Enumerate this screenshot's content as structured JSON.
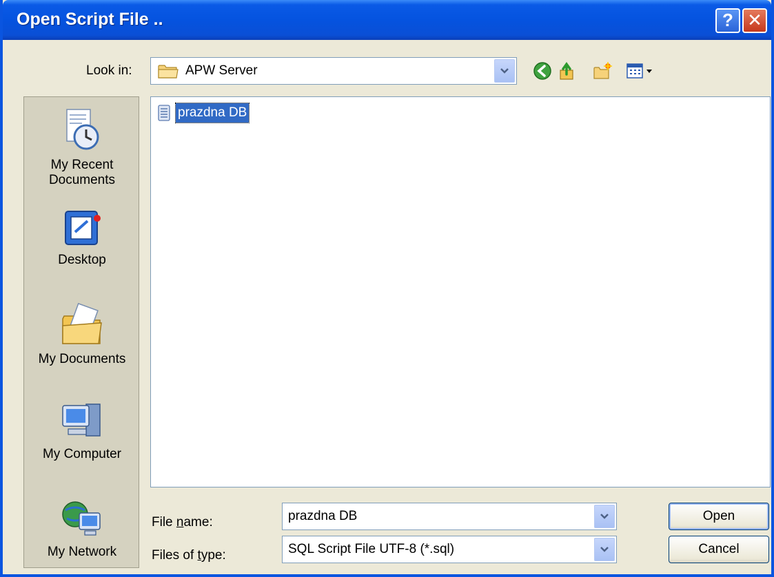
{
  "window": {
    "title": "Open Script File .."
  },
  "titlebar": {
    "help_glyph": "?",
    "close_glyph": "✕"
  },
  "lookin": {
    "label": "Look in:",
    "value": "APW Server"
  },
  "toolbar": {
    "icons": [
      "back-icon",
      "up-folder-icon",
      "new-folder-icon",
      "views-menu-icon"
    ]
  },
  "places": [
    {
      "line1": "My Recent",
      "line2": "Documents",
      "icon": "recent-documents-icon"
    },
    {
      "line1": "Desktop",
      "line2": "",
      "icon": "desktop-icon"
    },
    {
      "line1": "My Documents",
      "line2": "",
      "icon": "my-documents-icon"
    },
    {
      "line1": "My Computer",
      "line2": "",
      "icon": "my-computer-icon"
    },
    {
      "line1": "My Network",
      "line2": "",
      "icon": "my-network-icon"
    }
  ],
  "files": [
    {
      "name": "prazdna DB",
      "selected": true,
      "icon": "text-file-icon"
    }
  ],
  "filename": {
    "label": "File name:",
    "value": "prazdna DB"
  },
  "filetype": {
    "label": "Files of type:",
    "value": "SQL Script File UTF-8 (*.sql)"
  },
  "buttons": {
    "open": "Open",
    "cancel": "Cancel"
  },
  "colors": {
    "titlebar": "#0553df",
    "selection": "#316ac5",
    "dialog": "#ece9d8"
  }
}
